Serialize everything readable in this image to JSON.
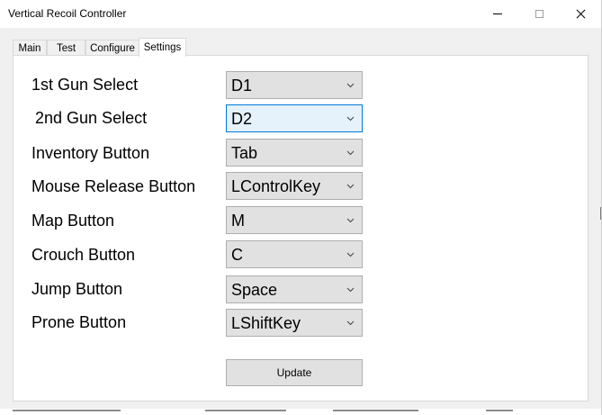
{
  "window": {
    "title": "Vertical Recoil Controller"
  },
  "tabs": [
    {
      "label": "Main",
      "active": false
    },
    {
      "label": "Test",
      "active": false
    },
    {
      "label": "Configure",
      "active": false
    },
    {
      "label": "Settings",
      "active": true
    }
  ],
  "settings": {
    "rows": [
      {
        "label": "1st Gun Select",
        "value": "D1"
      },
      {
        "label": "2nd Gun Select",
        "value": "D2",
        "focused": true
      },
      {
        "label": "Inventory Button",
        "value": "Tab"
      },
      {
        "label": "Mouse Release Button",
        "value": "LControlKey"
      },
      {
        "label": "Map Button",
        "value": "M"
      },
      {
        "label": "Crouch Button",
        "value": "C"
      },
      {
        "label": "Jump Button",
        "value": "Space"
      },
      {
        "label": "Prone Button",
        "value": "LShiftKey"
      }
    ],
    "update_label": "Update"
  },
  "icons": {
    "minimize": "minimize-icon",
    "maximize": "maximize-icon",
    "close": "close-icon",
    "dropdown": "chevron-down-icon"
  },
  "colors": {
    "focus_border": "#0078d7",
    "focus_fill": "#e5f1fb",
    "control_fill": "#e1e1e1"
  }
}
